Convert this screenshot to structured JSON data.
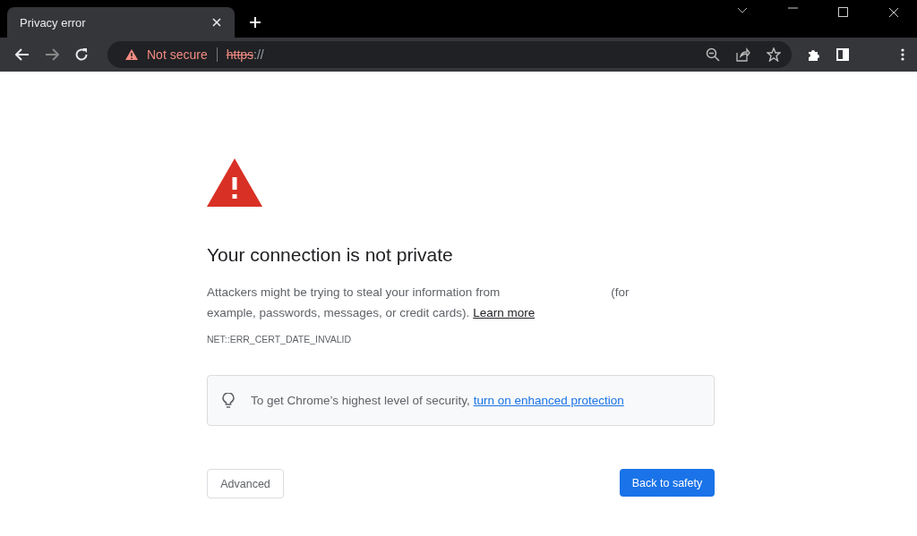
{
  "tab": {
    "title": "Privacy error",
    "selected": true
  },
  "omnibox": {
    "security": "Not secure",
    "scheme": "https",
    "rest": "://"
  },
  "page": {
    "heading": "Your connection is not private",
    "paragraph_start": "Attackers might be trying to steal your information from",
    "paragraph_end": "(for example, passwords, messages, or credit cards).",
    "learn_more": "Learn more",
    "error_code": "NET::ERR_CERT_DATE_INVALID",
    "tip_text": "To get Chrome’s highest level of security,",
    "tip_link": "turn on enhanced protection",
    "advanced": "Advanced",
    "back": "Back to safety"
  }
}
